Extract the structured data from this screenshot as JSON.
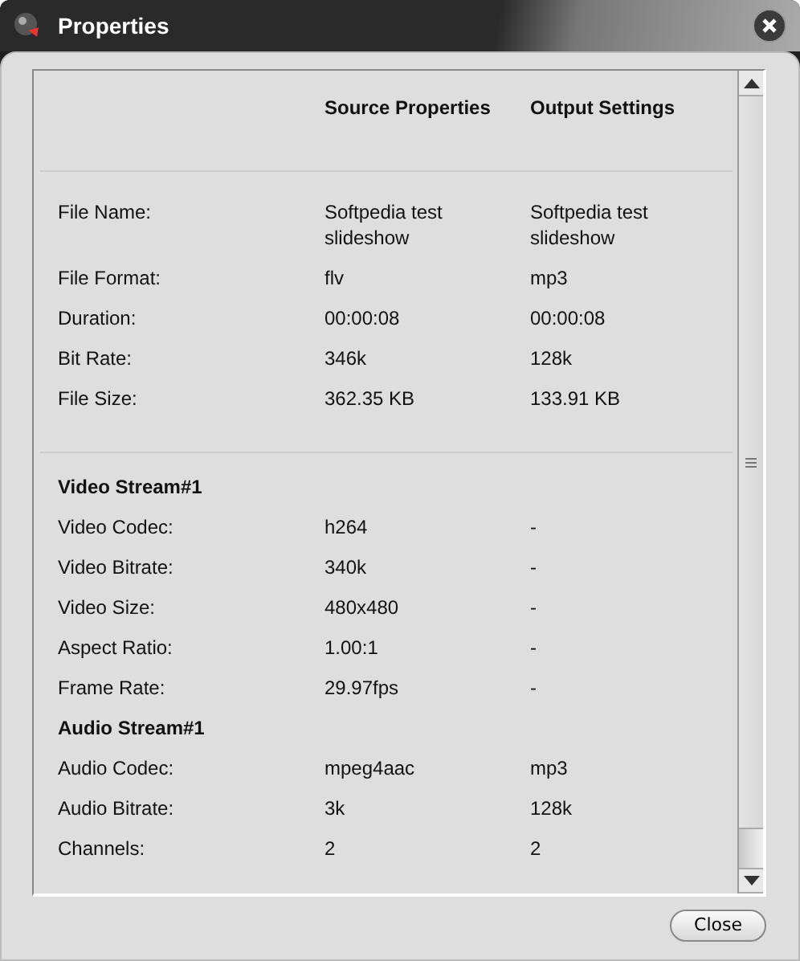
{
  "window": {
    "title": "Properties"
  },
  "columns": [
    "Source Properties",
    "Output Settings"
  ],
  "sections": [
    {
      "rows": [
        {
          "label": "File Name:",
          "source": "Softpedia test slideshow",
          "output": "Softpedia test slideshow"
        },
        {
          "label": "File Format:",
          "source": "flv",
          "output": "mp3"
        },
        {
          "label": "Duration:",
          "source": "00:00:08",
          "output": "00:00:08"
        },
        {
          "label": "Bit Rate:",
          "source": "346k",
          "output": "128k"
        },
        {
          "label": "File Size:",
          "source": "362.35 KB",
          "output": "133.91 KB"
        }
      ]
    },
    {
      "title": "Video Stream#1",
      "rows": [
        {
          "label": "Video Codec:",
          "source": "h264",
          "output": "-"
        },
        {
          "label": "Video Bitrate:",
          "source": "340k",
          "output": "-"
        },
        {
          "label": "Video Size:",
          "source": "480x480",
          "output": "-"
        },
        {
          "label": "Aspect Ratio:",
          "source": "1.00:1",
          "output": "-"
        },
        {
          "label": "Frame Rate:",
          "source": "29.97fps",
          "output": "-"
        }
      ]
    },
    {
      "title": "Audio Stream#1",
      "rows": [
        {
          "label": "Audio Codec:",
          "source": "mpeg4aac",
          "output": "mp3"
        },
        {
          "label": "Audio Bitrate:",
          "source": "3k",
          "output": "128k"
        },
        {
          "label": "Channels:",
          "source": "2",
          "output": "2"
        }
      ]
    }
  ],
  "buttons": [
    "Close"
  ]
}
